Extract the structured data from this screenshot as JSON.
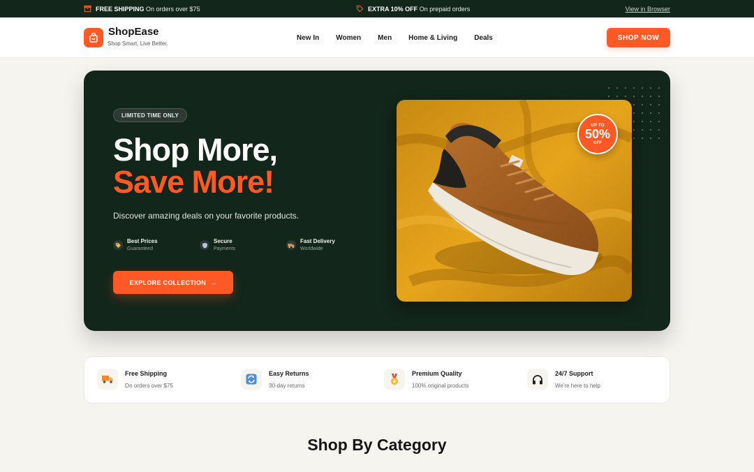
{
  "topbar": {
    "promo1_bold": "FREE SHIPPING",
    "promo1_rest": "On orders over $75",
    "promo1_icon": "box-icon",
    "promo2_bold": "EXTRA 10% OFF",
    "promo2_rest": "On prepaid orders",
    "promo2_icon": "tag-icon",
    "view_in_browser": "View in Browser"
  },
  "header": {
    "brand": "ShopEase",
    "tagline": "Shop Smart. Live Better.",
    "nav": [
      "New In",
      "Women",
      "Men",
      "Home & Living",
      "Deals"
    ],
    "cta": "SHOP NOW"
  },
  "hero": {
    "badge": "LIMITED TIME ONLY",
    "title_line1": "Shop More,",
    "title_line2": "Save More!",
    "subtitle": "Discover amazing deals on your favorite products.",
    "features": [
      {
        "title": "Best Prices",
        "subtitle": "Guaranteed",
        "icon": "tag-icon"
      },
      {
        "title": "Secure",
        "subtitle": "Payments",
        "icon": "shield-icon"
      },
      {
        "title": "Fast Delivery",
        "subtitle": "Worldwide",
        "icon": "truck-icon"
      }
    ],
    "cta": "EXPLORE COLLECTION",
    "cta_arrow": "→",
    "sale": {
      "top": "UP TO",
      "value": "50%",
      "bottom": "OFF"
    }
  },
  "strip": [
    {
      "title": "Free Shipping",
      "subtitle": "On orders over $75",
      "icon": "truck-icon"
    },
    {
      "title": "Easy Returns",
      "subtitle": "30-day returns",
      "icon": "refresh-icon"
    },
    {
      "title": "Premium Quality",
      "subtitle": "100% original products",
      "icon": "medal-icon"
    },
    {
      "title": "24/7 Support",
      "subtitle": "We're here to help",
      "icon": "headphones-icon"
    }
  ],
  "section_title": "Shop By Category",
  "colors": {
    "accent": "#ff5a25",
    "dark": "#13261b",
    "bg": "#f6f4ef"
  }
}
